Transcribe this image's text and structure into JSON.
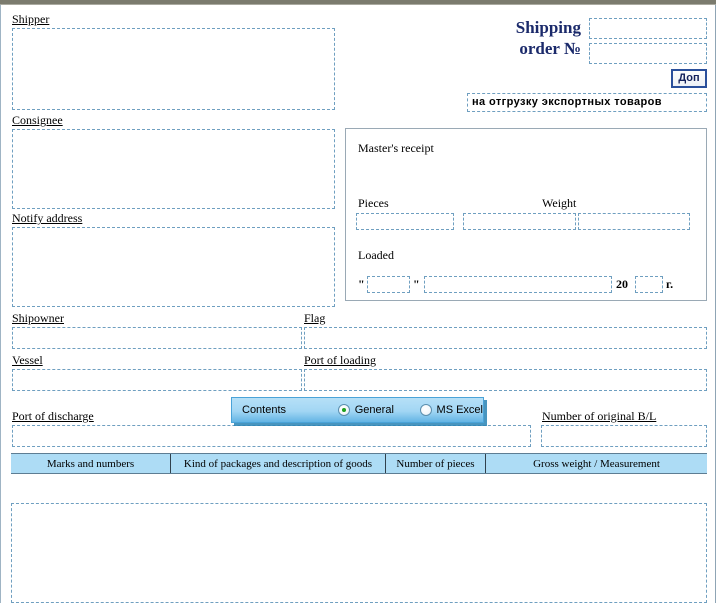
{
  "header": {
    "title_line1": "Shipping",
    "title_line2": "order №",
    "order_no_value": "",
    "order_no_placeholder": "",
    "order_sub_value": "",
    "dop_button": "Доп",
    "purpose_text": "на отгрузку экспортных товаров"
  },
  "left_fields": {
    "shipper_label": "Shipper",
    "shipper_value": "",
    "consignee_label": "Consignee",
    "consignee_value": "",
    "notify_label": "Notify address",
    "notify_value": "",
    "shipowner_label": "Shipowner",
    "shipowner_value": "",
    "vessel_label": "Vessel",
    "vessel_value": "",
    "port_discharge_label": "Port of discharge",
    "port_discharge_value": ""
  },
  "right_fields": {
    "flag_label": "Flag",
    "flag_value": "",
    "port_loading_label": "Port of loading",
    "port_loading_value": "",
    "bl_label": "Number of original B/L",
    "bl_value": ""
  },
  "masters_receipt": {
    "title": "Master's receipt",
    "pieces_label": "Pieces",
    "pieces_value": "",
    "weight_label": "Weight",
    "weight_value_1": "",
    "weight_value_2": "",
    "loaded_label": "Loaded",
    "quote_open": "\"",
    "quote_close": "\"",
    "day_value": "",
    "month_value": "",
    "year_prefix": "20",
    "year_value": "",
    "year_suffix": "г."
  },
  "contents_panel": {
    "label": "Contents",
    "options": [
      {
        "label": "General",
        "selected": true
      },
      {
        "label": "MS Excel",
        "selected": false
      }
    ]
  },
  "goods_table": {
    "columns": [
      "Marks and numbers",
      "Kind of packages and description of goods",
      "Number of pieces",
      "Gross weight / Measurement"
    ],
    "body_value": ""
  },
  "colors": {
    "title_blue": "#1b2a6b",
    "panel_blue": "#a2d6f4",
    "table_header_blue": "#addcf5",
    "dotted_border": "#6f9fc0",
    "radio_selected_green": "#1fa01f"
  }
}
